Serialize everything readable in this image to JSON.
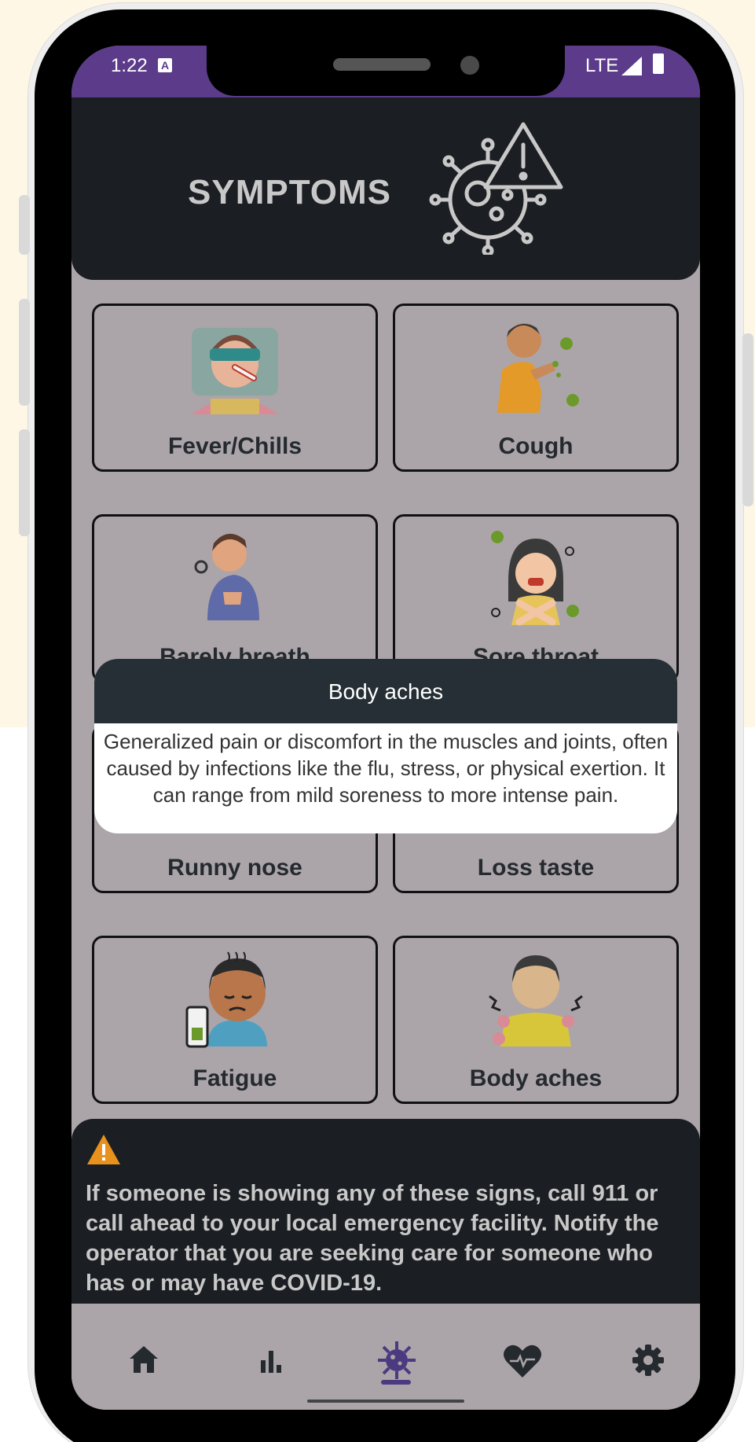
{
  "status_bar": {
    "time": "1:22",
    "a_badge": "A",
    "network": "LTE"
  },
  "header": {
    "title": "SYMPTOMS"
  },
  "cards": [
    {
      "label": "Fever/Chills"
    },
    {
      "label": "Cough"
    },
    {
      "label": "Barely breath"
    },
    {
      "label": "Sore throat"
    },
    {
      "label": "Runny nose"
    },
    {
      "label": "Loss taste"
    },
    {
      "label": "Fatigue"
    },
    {
      "label": "Body aches"
    }
  ],
  "popup": {
    "title": "Body aches",
    "description": "Generalized pain or discomfort in the muscles and joints, often caused by infections like the flu, stress, or physical exertion. It can range from mild soreness to more intense pain."
  },
  "warning": {
    "text": "If someone is showing any of these signs, call 911 or call ahead to your local emergency facility. Notify the operator that you are seeking care for someone who has or may have COVID-19."
  },
  "nav": {
    "items": [
      "home-icon",
      "chart-icon",
      "virus-icon",
      "heart-icon",
      "settings-icon"
    ],
    "active_index": 2,
    "active_color": "#4b3a80",
    "inactive_color": "#252a2e"
  }
}
